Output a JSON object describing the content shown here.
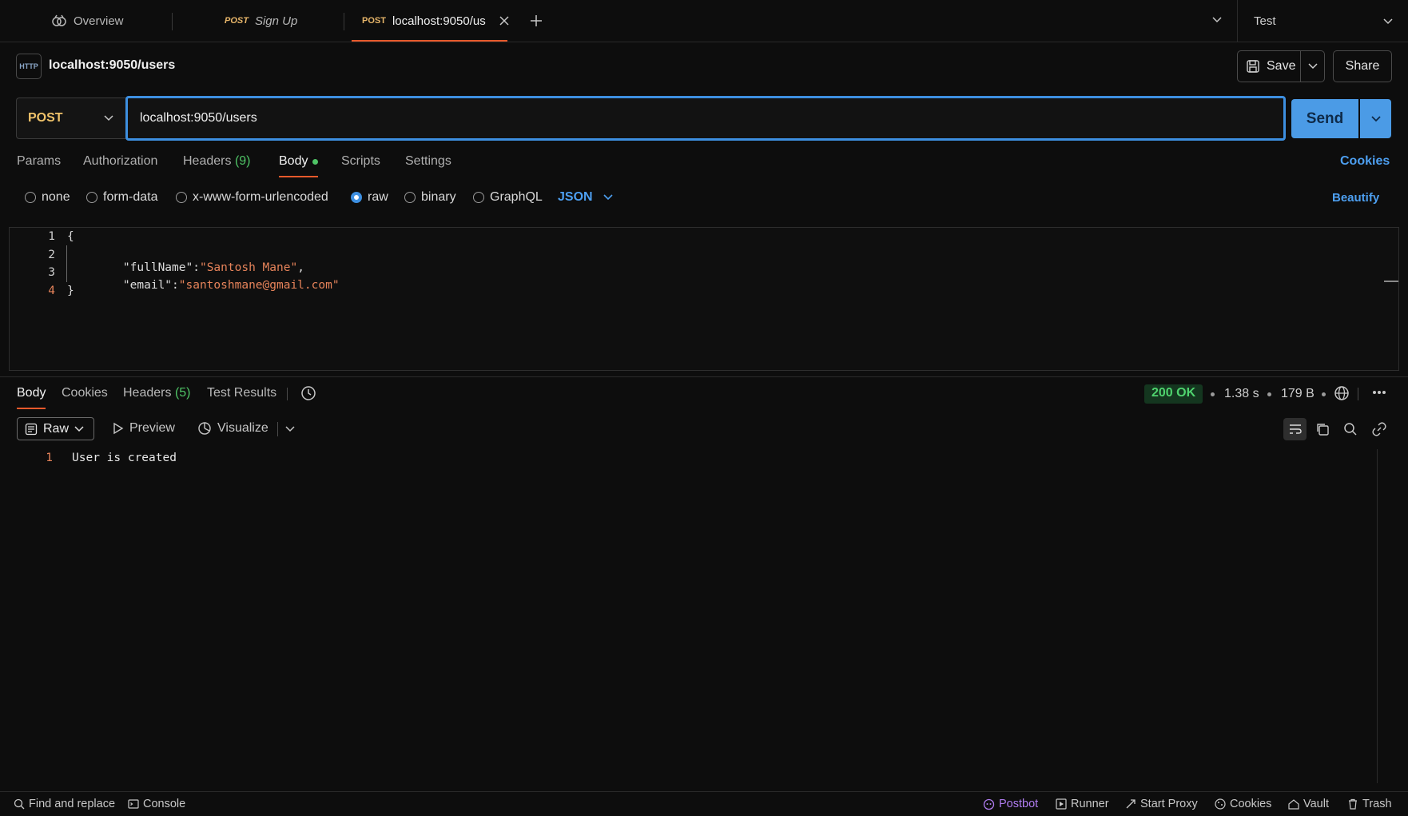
{
  "tabs": {
    "overview": "Overview",
    "signup_method": "POST",
    "signup_label": "Sign Up",
    "active_method": "POST",
    "active_label": "localhost:9050/us"
  },
  "environment": {
    "selected": "Test"
  },
  "request": {
    "title": "localhost:9050/users",
    "save_label": "Save",
    "share_label": "Share",
    "method": "POST",
    "url": "localhost:9050/users",
    "send_label": "Send"
  },
  "request_tabs": {
    "params": "Params",
    "authorization": "Authorization",
    "headers": "Headers",
    "headers_count": "(9)",
    "body": "Body",
    "scripts": "Scripts",
    "settings": "Settings",
    "cookies": "Cookies"
  },
  "body_modes": {
    "none": "none",
    "form_data": "form-data",
    "urlencoded": "x-www-form-urlencoded",
    "raw": "raw",
    "binary": "binary",
    "graphql": "GraphQL",
    "format": "JSON",
    "beautify": "Beautify"
  },
  "editor": {
    "lines": [
      {
        "num": "1",
        "open": "{"
      },
      {
        "num": "2",
        "key": "\"fullName\"",
        "sep": ":",
        "value": "\"Santosh Mane\"",
        "trail": ","
      },
      {
        "num": "3",
        "key": "\"email\"",
        "sep": ":",
        "value": "\"santoshmane@gmail.com\"",
        "trail": ""
      },
      {
        "num": "4",
        "close": "}"
      }
    ]
  },
  "response_tabs": {
    "body": "Body",
    "cookies": "Cookies",
    "headers": "Headers",
    "headers_count": "(5)",
    "test_results": "Test Results"
  },
  "response_meta": {
    "status": "200 OK",
    "time": "1.38 s",
    "size": "179 B"
  },
  "response_view": {
    "raw": "Raw",
    "preview": "Preview",
    "visualize": "Visualize"
  },
  "response_body": {
    "line_num": "1",
    "text": "User is created"
  },
  "statusbar": {
    "find_replace": "Find and replace",
    "console": "Console",
    "postbot": "Postbot",
    "runner": "Runner",
    "start_proxy": "Start Proxy",
    "cookies": "Cookies",
    "vault": "Vault",
    "trash": "Trash"
  },
  "colors": {
    "accent_blue": "#3d8fe0",
    "send_button": "#4b9be6",
    "status_ok": "#4fd36e",
    "method_post": "#f0c36a",
    "active_tab_indicator": "#e8592b",
    "postbot": "#b07cf0"
  }
}
